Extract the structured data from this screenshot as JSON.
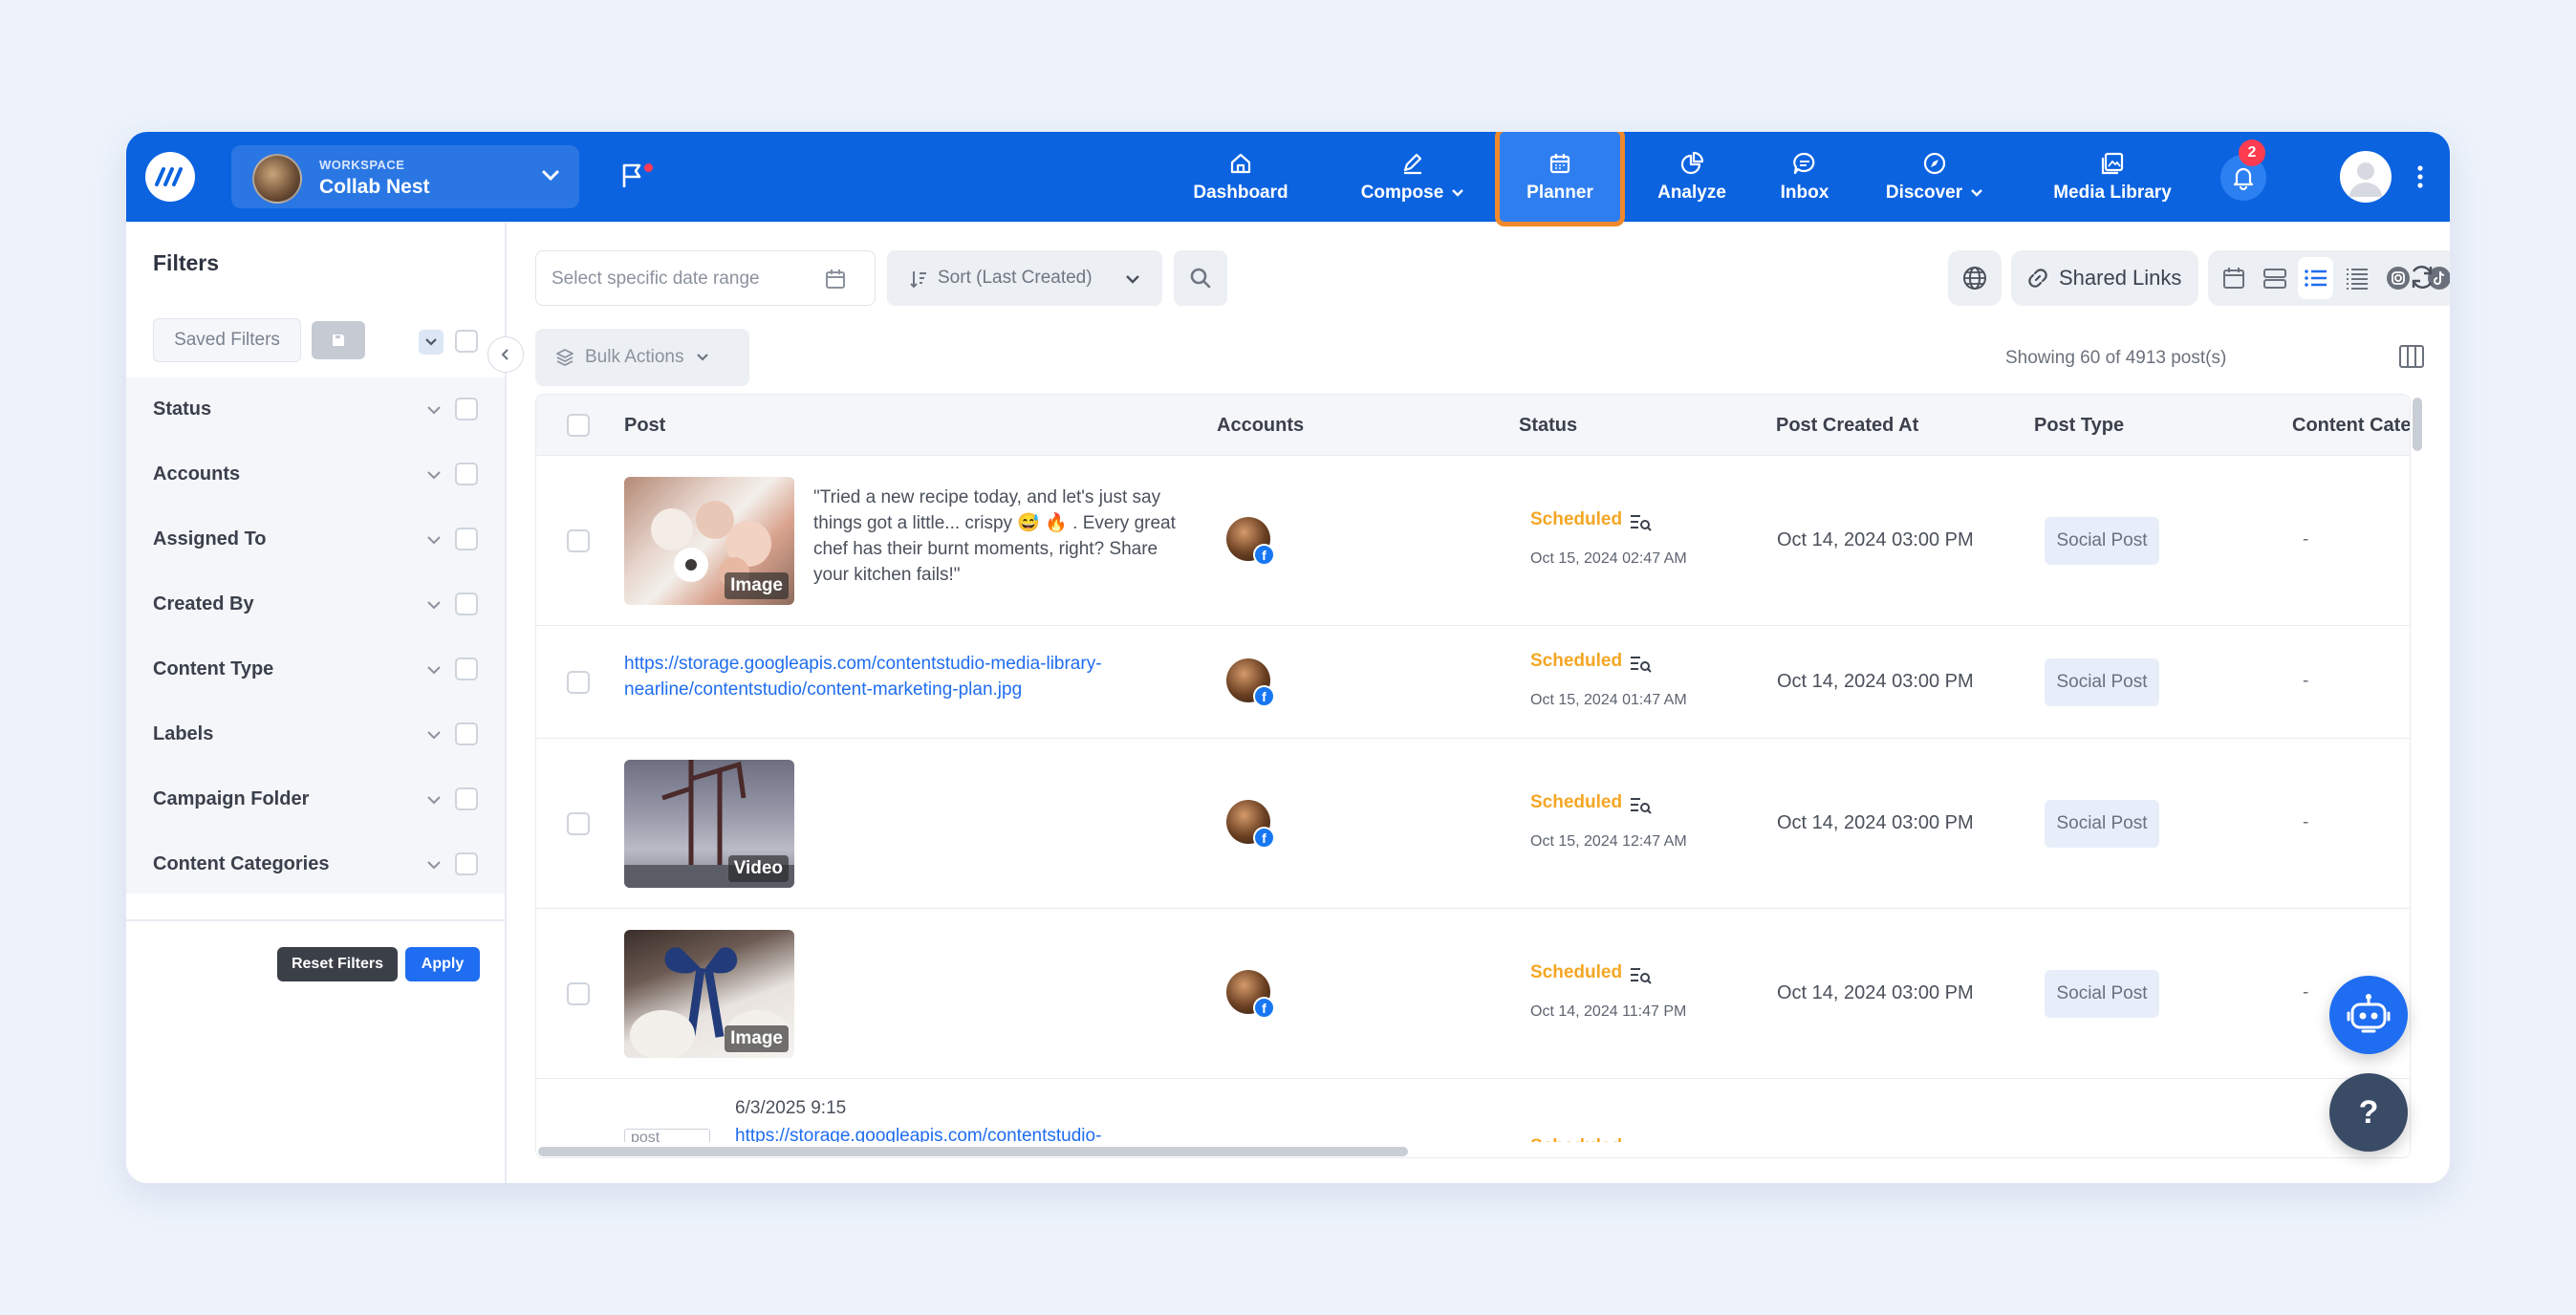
{
  "workspace": {
    "label": "WORKSPACE",
    "name": "Collab Nest"
  },
  "nav": {
    "dashboard": "Dashboard",
    "compose": "Compose",
    "planner": "Planner",
    "analyze": "Analyze",
    "inbox": "Inbox",
    "discover": "Discover",
    "media_library": "Media Library",
    "notifications_count": "2"
  },
  "sidebar": {
    "title": "Filters",
    "saved_filters": "Saved Filters",
    "filters": [
      "Status",
      "Accounts",
      "Assigned To",
      "Created By",
      "Content Type",
      "Labels",
      "Campaign Folder",
      "Content Categories"
    ],
    "reset": "Reset Filters",
    "apply": "Apply"
  },
  "toolbar": {
    "date_placeholder": "Select specific date range",
    "sort": "Sort (Last Created)",
    "shared_links": "Shared Links",
    "bulk_actions": "Bulk Actions",
    "showing": "Showing 60 of 4913 post(s)"
  },
  "table": {
    "headers": [
      "Post",
      "Accounts",
      "Status",
      "Post Created At",
      "Post Type",
      "Content Cate"
    ],
    "rows": [
      {
        "media_tag": "Image",
        "caption": "\"Tried a new recipe today, and let's just say things got a little... crispy 😅 🔥 . Every great chef has their burnt moments, right? Share your kitchen fails!\"",
        "status": "Scheduled",
        "status_time": "Oct 15, 2024 02:47 AM",
        "created": "Oct 14, 2024 03:00 PM",
        "type": "Social Post",
        "category": "-"
      },
      {
        "link": "https://storage.googleapis.com/contentstudio-media-library-nearline/contentstudio/content-marketing-plan.jpg",
        "status": "Scheduled",
        "status_time": "Oct 15, 2024 01:47 AM",
        "created": "Oct 14, 2024 03:00 PM",
        "type": "Social Post",
        "category": "-"
      },
      {
        "media_tag": "Video",
        "status": "Scheduled",
        "status_time": "Oct 15, 2024 12:47 AM",
        "created": "Oct 14, 2024 03:00 PM",
        "type": "Social Post",
        "category": "-"
      },
      {
        "media_tag": "Image",
        "status": "Scheduled",
        "status_time": "Oct 14, 2024 11:47 PM",
        "created": "Oct 14, 2024 03:00 PM",
        "type": "Social Post",
        "category": "-"
      },
      {
        "date": "6/3/2025 9:15",
        "link": "https://storage.googleapis.com/contentstudio-",
        "img_alt": "post",
        "status": "Scheduled"
      }
    ]
  },
  "colors": {
    "brand": "#0b63e0",
    "accent": "#f0892b",
    "scheduled": "#f5a623"
  }
}
